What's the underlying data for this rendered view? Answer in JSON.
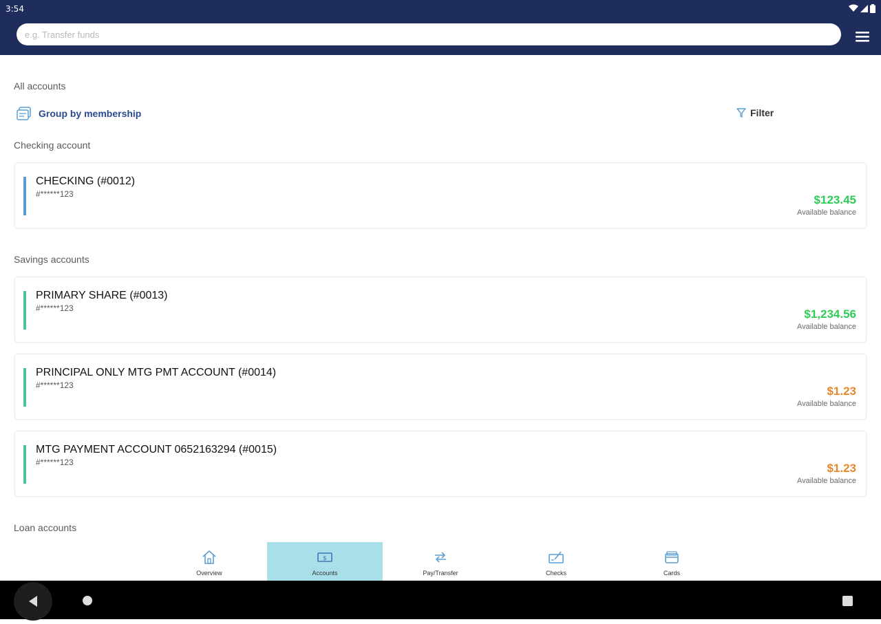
{
  "status_bar": {
    "time": "3:54"
  },
  "search": {
    "placeholder": "e.g. Transfer funds"
  },
  "page": {
    "heading": "All accounts",
    "group_by_label": "Group by membership",
    "filter_label": "Filter"
  },
  "sections": {
    "checking": "Checking account",
    "savings": "Savings accounts",
    "loan": "Loan accounts"
  },
  "accounts": [
    {
      "name": "CHECKING (#0012)",
      "number": "#******123",
      "amount": "$123.45",
      "amount_label": "Available balance",
      "bar_color": "#5b9bd5",
      "amount_color": "#2ecc55"
    },
    {
      "name": "PRIMARY SHARE (#0013)",
      "number": "#******123",
      "amount": "$1,234.56",
      "amount_label": "Available balance",
      "bar_color": "#4dbf9a",
      "amount_color": "#2ecc55"
    },
    {
      "name": "PRINCIPAL ONLY MTG PMT ACCOUNT (#0014)",
      "number": "#******123",
      "amount": "$1.23",
      "amount_label": "Available balance",
      "bar_color": "#4dbf9a",
      "amount_color": "#e8862a"
    },
    {
      "name": "MTG PAYMENT ACCOUNT 0652163294 (#0015)",
      "number": "#******123",
      "amount": "$1.23",
      "amount_label": "Available balance",
      "bar_color": "#4dbf9a",
      "amount_color": "#e8862a"
    }
  ],
  "bottom_nav": [
    {
      "label": "Overview",
      "icon": "home-icon"
    },
    {
      "label": "Accounts",
      "icon": "dollar-bill-icon",
      "active": true
    },
    {
      "label": "Pay/Transfer",
      "icon": "transfer-arrows-icon"
    },
    {
      "label": "Checks",
      "icon": "check-deposit-icon"
    },
    {
      "label": "Cards",
      "icon": "card-icon"
    }
  ],
  "colors": {
    "header": "#1f2d5c",
    "accent_blue": "#2a4a8f",
    "nav_active": "#a8dfe8",
    "icon_blue": "#5a9fd4"
  }
}
